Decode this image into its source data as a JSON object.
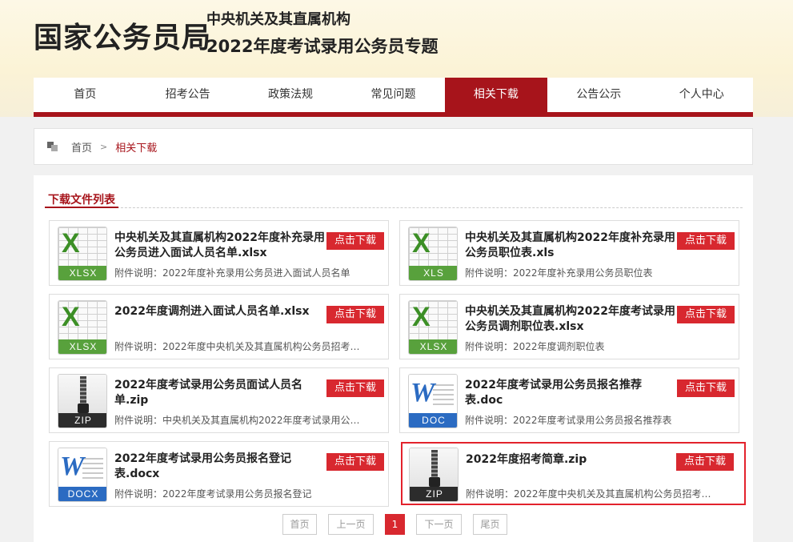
{
  "header": {
    "logo": "国家公务员局",
    "subtitle_line1": "中央机关及其直属机构",
    "subtitle_line2": "2022年度考试录用公务员专题"
  },
  "nav": {
    "items": [
      {
        "label": "首页"
      },
      {
        "label": "招考公告"
      },
      {
        "label": "政策法规"
      },
      {
        "label": "常见问题"
      },
      {
        "label": "相关下载",
        "active": true
      },
      {
        "label": "公告公示"
      },
      {
        "label": "个人中心"
      }
    ]
  },
  "breadcrumb": {
    "home": "首页",
    "separator": ">",
    "current": "相关下载"
  },
  "panel": {
    "title": "下载文件列表"
  },
  "files": [
    {
      "title": "中央机关及其直属机构2022年度补充录用公务员进入面试人员名单.xlsx",
      "desc": "附件说明：2022年度补充录用公务员进入面试人员名单",
      "type": "XLSX",
      "icon": "excel-icon",
      "button": "点击下载"
    },
    {
      "title": "中央机关及其直属机构2022年度补充录用公务员职位表.xls",
      "desc": "附件说明：2022年度补充录用公务员职位表",
      "type": "XLS",
      "icon": "excel-icon",
      "button": "点击下载"
    },
    {
      "title": "2022年度调剂进入面试人员名单.xlsx",
      "desc": "附件说明：2022年度中央机关及其直属机构公务员招考…",
      "type": "XLSX",
      "icon": "excel-icon",
      "button": "点击下载"
    },
    {
      "title": "中央机关及其直属机构2022年度考试录用公务员调剂职位表.xlsx",
      "desc": "附件说明：2022年度调剂职位表",
      "type": "XLSX",
      "icon": "excel-icon",
      "button": "点击下载"
    },
    {
      "title": "2022年度考试录用公务员面试人员名单.zip",
      "desc": "附件说明：中央机关及其直属机构2022年度考试录用公…",
      "type": "ZIP",
      "icon": "zip-icon",
      "button": "点击下载"
    },
    {
      "title": "2022年度考试录用公务员报名推荐表.doc",
      "desc": "附件说明：2022年度考试录用公务员报名推荐表",
      "type": "DOC",
      "icon": "word-icon",
      "button": "点击下载"
    },
    {
      "title": "2022年度考试录用公务员报名登记表.docx",
      "desc": "附件说明：2022年度考试录用公务员报名登记",
      "type": "DOCX",
      "icon": "word-icon",
      "button": "点击下载"
    },
    {
      "title": "2022年度招考简章.zip",
      "desc": "附件说明：2022年度中央机关及其直属机构公务员招考…",
      "type": "ZIP",
      "icon": "zip-icon",
      "button": "点击下载",
      "selected": true
    }
  ],
  "pagination": {
    "first": "首页",
    "prev": "上一页",
    "current": "1",
    "next": "下一页",
    "last": "尾页"
  },
  "colors": {
    "brand_red": "#a7141b",
    "button_red": "#d8282f"
  }
}
